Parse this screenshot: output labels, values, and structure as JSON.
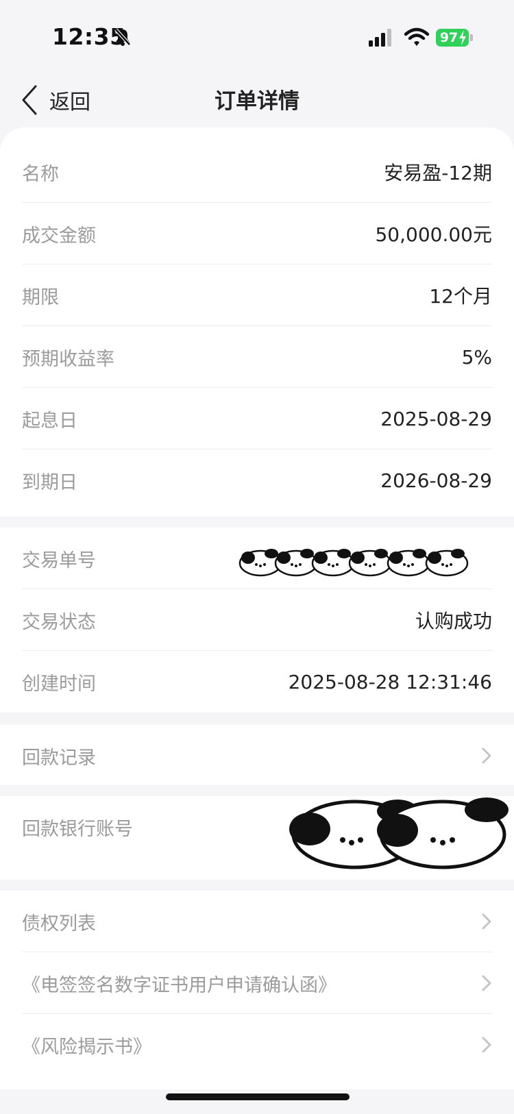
{
  "status_bar": {
    "time": "12:35",
    "battery": "97"
  },
  "nav": {
    "back_label": "返回",
    "title": "订单详情"
  },
  "details": [
    {
      "label": "名称",
      "value": "安易盈-12期"
    },
    {
      "label": "成交金额",
      "value": "50,000.00元"
    },
    {
      "label": "期限",
      "value": "12个月"
    },
    {
      "label": "预期收益率",
      "value": "5%"
    },
    {
      "label": "起息日",
      "value": "2025-08-29"
    },
    {
      "label": "到期日",
      "value": "2026-08-29"
    }
  ],
  "transaction": [
    {
      "label": "交易单号",
      "value": ""
    },
    {
      "label": "交易状态",
      "value": "认购成功"
    },
    {
      "label": "创建时间",
      "value": "2025-08-28 12:31:46"
    }
  ],
  "refund_record": {
    "label": "回款记录"
  },
  "refund_account": {
    "label": "回款银行账号"
  },
  "documents": [
    {
      "label": "债权列表"
    },
    {
      "label": "《电签签名数字证书用户申请确认函》"
    },
    {
      "label": "《风险揭示书》"
    }
  ],
  "colors": {
    "background": "#f5f5f7",
    "card": "#ffffff",
    "label": "#9b9b9b",
    "value": "#222222",
    "battery": "#2fd158"
  }
}
